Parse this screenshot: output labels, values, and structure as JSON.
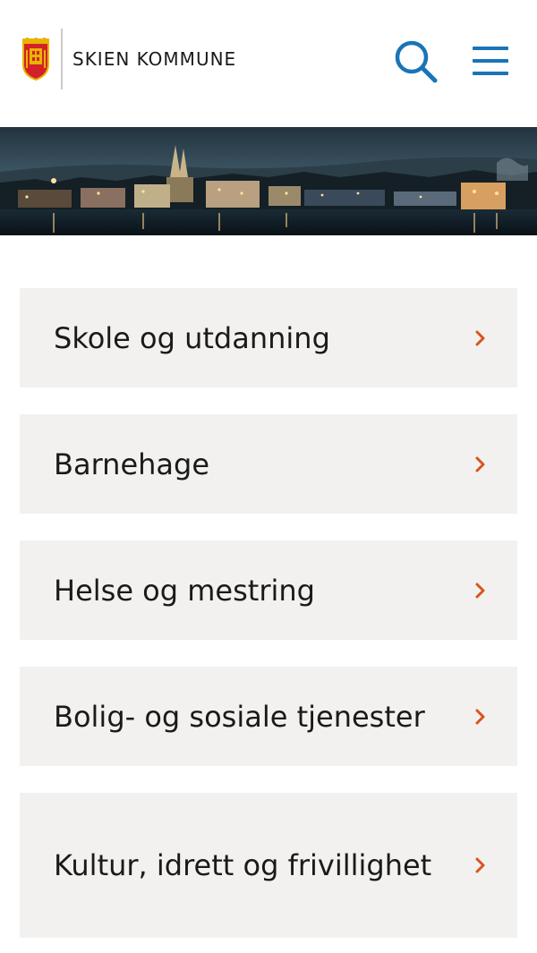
{
  "header": {
    "brand": "SKIEN KOMMUNE",
    "logo_icon": "coat-of-arms-icon",
    "search_icon": "search-icon",
    "menu_icon": "hamburger-menu-icon"
  },
  "colors": {
    "accent_blue": "#1a74b8",
    "chevron_orange": "#d9531e",
    "card_background": "#f2f1ef"
  },
  "banner": {
    "description_icon": "city-night-photo"
  },
  "nav": {
    "items": [
      {
        "label": "Skole og utdanning"
      },
      {
        "label": "Barnehage"
      },
      {
        "label": "Helse og mestring"
      },
      {
        "label": "Bolig- og sosiale tjenester"
      },
      {
        "label": "Kultur, idrett og frivillighet"
      }
    ]
  }
}
